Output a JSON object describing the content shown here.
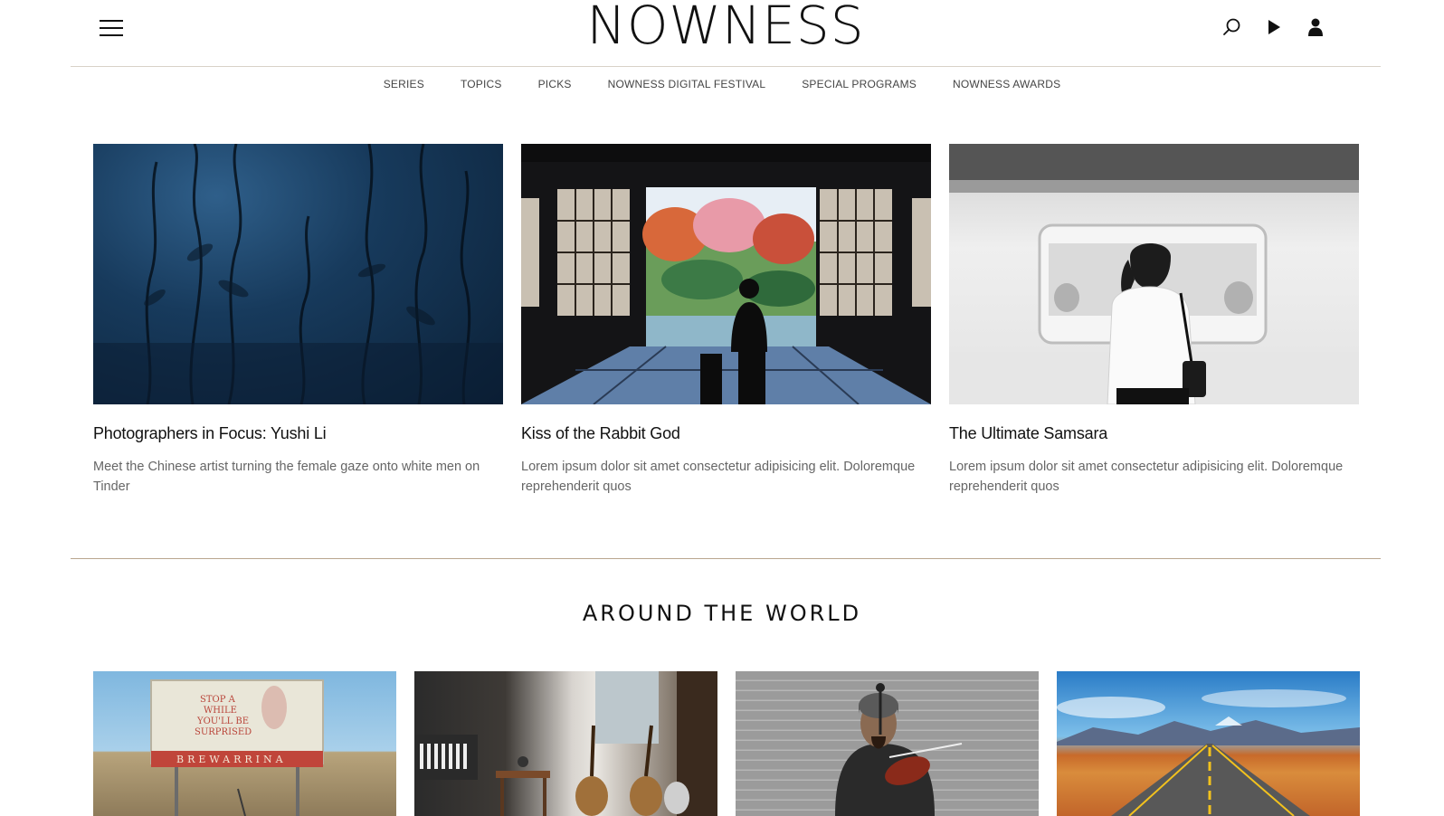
{
  "brand": {
    "logo": "NOWNESS"
  },
  "header": {
    "icons": [
      "menu-icon",
      "search-icon",
      "play-icon",
      "user-icon"
    ]
  },
  "subnav": {
    "items": [
      {
        "label": "SERIES"
      },
      {
        "label": "TOPICS"
      },
      {
        "label": "PICKS"
      },
      {
        "label": "NOWNESS DIGITAL FESTIVAL"
      },
      {
        "label": "SPECIAL PROGRAMS"
      },
      {
        "label": "NOWNESS AWARDS"
      }
    ]
  },
  "featured": [
    {
      "title": "Photographers in Focus: Yushi Li",
      "description": "Meet the Chinese artist turning the female gaze onto white men on Tinder"
    },
    {
      "title": "Kiss of the Rabbit God",
      "description": "Lorem ipsum dolor sit amet consectetur adipisicing elit. Doloremque reprehenderit quos"
    },
    {
      "title": "The Ultimate Samsara",
      "description": "Lorem ipsum dolor sit amet consectetur adipisicing elit. Doloremque reprehenderit quos"
    }
  ],
  "around_the_world": {
    "title": "AROUND THE WORLD",
    "sign_text": [
      "STOP A",
      "WHILE",
      "YOU'LL BE",
      "SURPRISED",
      "BREWARRINA"
    ]
  },
  "colors": {
    "divider": "#b9a58f",
    "text_muted": "#666666"
  }
}
